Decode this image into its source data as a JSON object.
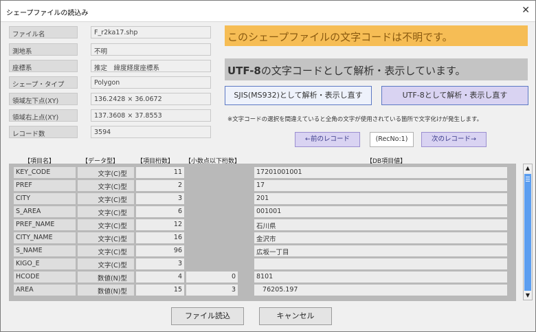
{
  "window": {
    "title": "シェープファイルの読込み",
    "close_glyph": "✕"
  },
  "props": [
    {
      "label": "ファイル名",
      "value": "F_r2ka17.shp"
    },
    {
      "label": "測地系",
      "value": "不明"
    },
    {
      "label": "座標系",
      "value": "推定　緯度経度座標系"
    },
    {
      "label": "シェープ・タイプ",
      "value": "Polygon"
    },
    {
      "label": "領域左下点(XY)",
      "value": "136.2428 × 36.0672"
    },
    {
      "label": "領域右上点(XY)",
      "value": "137.3608 × 37.8553"
    },
    {
      "label": "レコード数",
      "value": "3594"
    }
  ],
  "warning": "このシェープファイルの文字コードは不明です。",
  "info": {
    "bold": "UTF-8",
    "rest": "の文字コードとして解析・表示しています。"
  },
  "buttons": {
    "sjis": "SJIS(MS932)として解析・表示し直す",
    "utf8": "UTF-8として解析・表示し直す",
    "prev": "←前のレコード",
    "next": "次のレコード→",
    "open": "ファイル読込",
    "cancel": "キャンセル"
  },
  "note": "※文字コードの選択を間違えていると全角の文字が使用されている箇所で文字化けが発生します。",
  "record_no": "(RecNo:1)",
  "headers": {
    "name": "【項目名】",
    "type": "【データ型】",
    "len": "【項目桁数】",
    "dec": "【小数点以下桁数】",
    "val": "【DB項目値】"
  },
  "rows": [
    {
      "name": "KEY_CODE",
      "type": "文字(C)型",
      "len": "11",
      "dec": "",
      "val": "17201001001"
    },
    {
      "name": "PREF",
      "type": "文字(C)型",
      "len": "2",
      "dec": "",
      "val": "17"
    },
    {
      "name": "CITY",
      "type": "文字(C)型",
      "len": "3",
      "dec": "",
      "val": "201"
    },
    {
      "name": "S_AREA",
      "type": "文字(C)型",
      "len": "6",
      "dec": "",
      "val": "001001"
    },
    {
      "name": "PREF_NAME",
      "type": "文字(C)型",
      "len": "12",
      "dec": "",
      "val": "石川県"
    },
    {
      "name": "CITY_NAME",
      "type": "文字(C)型",
      "len": "16",
      "dec": "",
      "val": "金沢市"
    },
    {
      "name": "S_NAME",
      "type": "文字(C)型",
      "len": "96",
      "dec": "",
      "val": "広坂一丁目"
    },
    {
      "name": "KIGO_E",
      "type": "文字(C)型",
      "len": "3",
      "dec": "",
      "val": ""
    },
    {
      "name": "HCODE",
      "type": "数値(N)型",
      "len": "4",
      "dec": "0",
      "val": "8101"
    },
    {
      "name": "AREA",
      "type": "数値(N)型",
      "len": "15",
      "dec": "3",
      "val": "   76205.197"
    }
  ],
  "colors": {
    "warning_bg": "#f6bd55",
    "info_bg": "#c4c4c4",
    "accent": "#5c9ef0",
    "nav_bg": "#d9d3f2"
  }
}
